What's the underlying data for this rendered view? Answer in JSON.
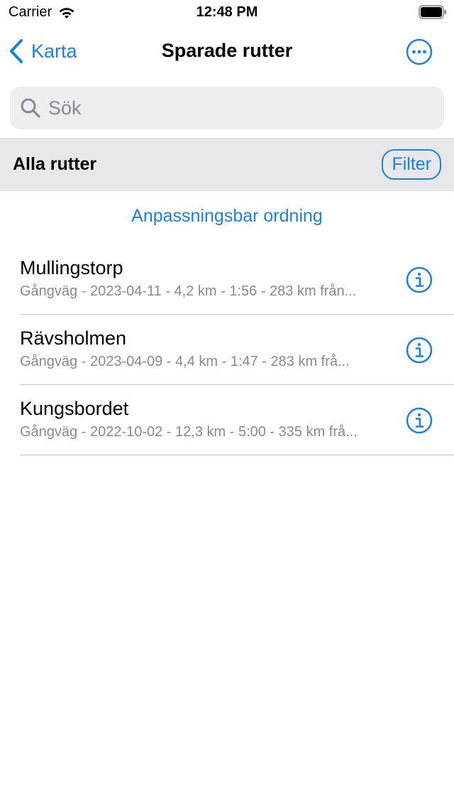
{
  "status_bar": {
    "carrier": "Carrier",
    "time": "12:48 PM"
  },
  "nav": {
    "back_label": "Karta",
    "title": "Sparade rutter"
  },
  "search": {
    "placeholder": "Sök",
    "value": ""
  },
  "section": {
    "title": "Alla rutter",
    "filter_label": "Filter"
  },
  "sort_label": "Anpassningsbar ordning",
  "routes": [
    {
      "name": "Mullingstorp",
      "meta": "Gångväg - 2023-04-11 - 4,2 km - 1:56 - 283 km från..."
    },
    {
      "name": "Rävsholmen",
      "meta": "Gångväg - 2023-04-09 - 4,4 km - 1:47 - 283 km frå..."
    },
    {
      "name": "Kungsbordet",
      "meta": "Gångväg - 2022-10-02 - 12,3 km - 5:00 - 335 km frå..."
    }
  ],
  "colors": {
    "accent": "#1a7fe6",
    "secondary_text": "#8a8a8e",
    "search_bg": "#eeeef0",
    "section_bg": "#e8e8ea"
  },
  "icons": {
    "back": "chevron-left-icon",
    "more": "ellipsis-circle-icon",
    "search": "magnifier-icon",
    "info": "info-circle-icon",
    "wifi": "wifi-icon",
    "battery": "battery-icon"
  }
}
